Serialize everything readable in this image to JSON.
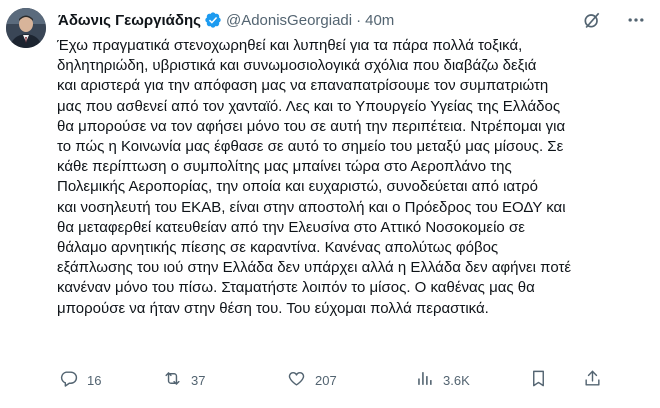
{
  "author": {
    "display_name": "Άδωνις Γεωργιάδης",
    "handle": "@AdonisGeorgiadi",
    "separator": "·",
    "time": "40m"
  },
  "icons": {
    "verified": "verified-badge-icon",
    "grok": "grok-icon",
    "more": "more-icon",
    "reply": "reply-icon",
    "retweet": "retweet-icon",
    "like": "heart-icon",
    "views": "views-icon",
    "bookmark": "bookmark-icon",
    "share": "share-icon"
  },
  "colors": {
    "verified": "#1d9bf0",
    "text": "#0f1419",
    "secondary": "#536471"
  },
  "tweet_lines": [
    "Έχω πραγματικά στενοχωρηθεί και λυπηθεί για τα πάρα πολλά τοξικά,",
    "δηλητηριώδη, υβριστικά και συνωμοσιολογικά σχόλια που διαβάζω δεξιά",
    "και αριστερά για την απόφαση μας να επαναπατρίσουμε τον συμπατριώτη",
    "μας που ασθενεί από τον χανταϊό. Λες και το Υπουργείο Υγείας της Ελλάδος",
    "θα μπορούσε να τον αφήσει μόνο του σε αυτή την περιπέτεια. Ντρέπομαι για",
    "το πώς η Κοινωνία μας έφθασε σε αυτό το σημείο του μεταξύ μας μίσους. Σε",
    "κάθε περίπτωση ο συμπολίτης μας μπαίνει τώρα στο Αεροπλάνο της",
    "Πολεμικής Αεροπορίας, την οποία και ευχαριστώ, συνοδεύεται από ιατρό",
    "και νοσηλευτή του ΕΚΑΒ, είναι στην αποστολή και ο Πρόεδρος του ΕΟΔΥ και",
    "θα μεταφερθεί κατευθείαν από την Ελευσίνα στο Αττικό Νοσοκομείο σε",
    "θάλαμο αρνητικής πίεσης σε καραντίνα. Κανένας απολύτως φόβος",
    "εξάπλωσης του ιού στην Ελλάδα δεν υπάρχει αλλά η Ελλάδα δεν αφήνει ποτέ",
    "κανέναν μόνο του πίσω. Σταματήστε λοιπόν το μίσος. Ο καθένας μας θα",
    "μπορούσε να ήταν στην θέση του. Του εύχομαι πολλά περαστικά."
  ],
  "stats": {
    "replies": "16",
    "retweets": "37",
    "likes": "207",
    "views": "3.6K"
  }
}
